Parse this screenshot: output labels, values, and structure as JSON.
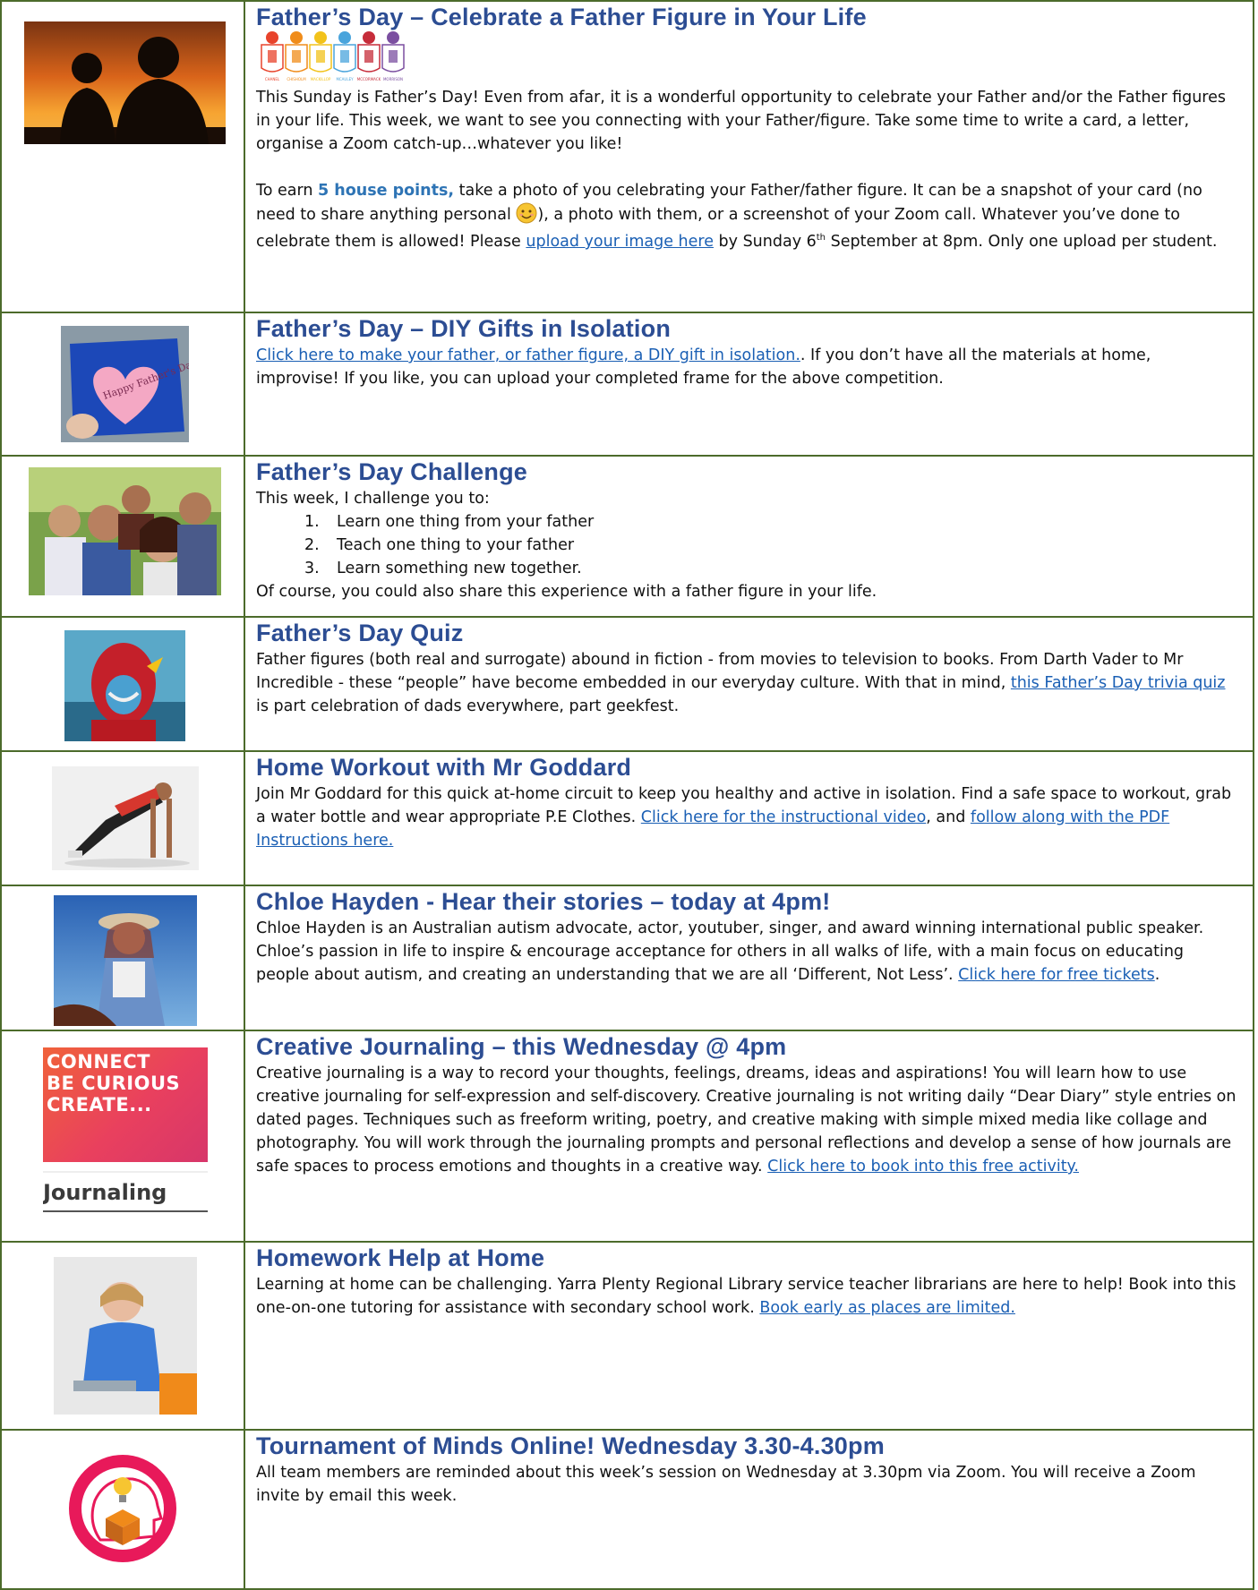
{
  "rows": [
    {
      "title": "Father’s Day – Celebrate a Father Figure in Your Life",
      "p1": "This Sunday is Father’s Day! Even from afar, it is a wonderful opportunity to celebrate your Father and/or the Father figures in your life. This week, we want to see you connecting with your Father/figure. Take some time to write a card, a letter, organise a Zoom catch-up…whatever you like!",
      "p2_a": "To earn ",
      "p2_points": "5 house points,",
      "p2_b": " take a photo of you celebrating your Father/father figure. It can be a snapshot of your card (no need to share anything personal ",
      "p2_c": "), a photo with them, or a screenshot of your Zoom call. Whatever you’ve done to celebrate them is allowed! Please ",
      "p2_link": "upload your image here",
      "p2_d": " by Sunday 6",
      "p2_sup": "th",
      "p2_e": " September at 8pm. Only one upload per student.",
      "house_labels": [
        "CHANEL",
        "CHISHOLM",
        "MACKILLOP",
        "MCAULEY",
        "MCCORMACK",
        "MORRISON"
      ],
      "house_colors": [
        "#e8432b",
        "#f08c1a",
        "#f2c21a",
        "#4aa4dc",
        "#c62c3a",
        "#7b4fa0"
      ]
    },
    {
      "title": "Father’s Day – DIY Gifts in Isolation",
      "link": "Click here to make your father, or father figure, a DIY gift in isolation.",
      "text": ". If you don’t have all the materials at home, improvise! If you like, you can upload your completed frame for the above competition.",
      "card_text": "Happy Father's Day"
    },
    {
      "title": "Father’s Day Challenge",
      "intro": "This week, I challenge you to:",
      "items": [
        {
          "n": "1.",
          "t": "Learn one thing from your father"
        },
        {
          "n": "2.",
          "t": "Teach one thing to your father"
        },
        {
          "n": "3.",
          "t": "Learn something new together."
        }
      ],
      "outro": "Of course, you could also share this experience with a father figure in your life."
    },
    {
      "title": "Father’s Day Quiz",
      "text_a": "Father figures (both real and surrogate) abound in fiction - from movies to television to books. From Darth Vader to Mr Incredible - these “people” have become embedded in our everyday culture. With that in mind, ",
      "link": "this Father’s Day trivia quiz",
      "text_b": " is part celebration of dads everywhere, part geekfest."
    },
    {
      "title": "Home Workout with Mr Goddard",
      "text_a": "Join Mr Goddard for this quick at-home circuit to keep you healthy and active in isolation. Find a safe space to workout, grab a water bottle and wear appropriate P.E Clothes. ",
      "link1": "Click here for the instructional video",
      "text_b": ", and ",
      "link2": "follow along with the PDF Instructions here."
    },
    {
      "title": "Chloe Hayden - Hear their stories – today at 4pm!",
      "text_a": "Chloe Hayden is an Australian autism advocate, actor, youtuber, singer, and award winning international public speaker. Chloe’s passion in life to inspire & encourage acceptance for others in all walks of life, with a main focus on educating people about autism, and creating an understanding that we are all ‘Different, Not Less’. ",
      "link": "Click here for free tickets",
      "text_b": "."
    },
    {
      "title": "Creative Journaling – this Wednesday @ 4pm",
      "text_a": "Creative journaling is a way to record your thoughts, feelings, dreams, ideas and aspirations! You will learn how to use creative journaling for self-expression and self-discovery. Creative journaling is not writing daily “Dear Diary” style entries on dated pages. Techniques such as freeform writing, poetry, and creative making with simple mixed media like collage and photography. You will work through the journaling prompts and personal reflections and develop a sense of how journals are safe spaces to process emotions and thoughts in a creative way. ",
      "link": "Click here to book into this free activity.",
      "badge_lines": [
        "CONNECT",
        "BE CURIOUS",
        "CREATE..."
      ],
      "badge_caption": "Journaling"
    },
    {
      "title": "Homework Help at Home",
      "text_a": "Learning at home can be challenging. Yarra Plenty Regional Library service teacher librarians are here to help! Book into this one-on-one tutoring for assistance with secondary school work. ",
      "link": "Book early as places are limited."
    },
    {
      "title": "Tournament of Minds Online! Wednesday 3.30-4.30pm",
      "text": "All team members are reminded about this week’s session on Wednesday at 3.30pm via Zoom. You will receive a Zoom invite by email this week."
    }
  ],
  "colors": {
    "border": "#4c6b2b",
    "title": "#2c4d93",
    "link": "#1a5fb4",
    "house_points": "#2e74b5"
  }
}
